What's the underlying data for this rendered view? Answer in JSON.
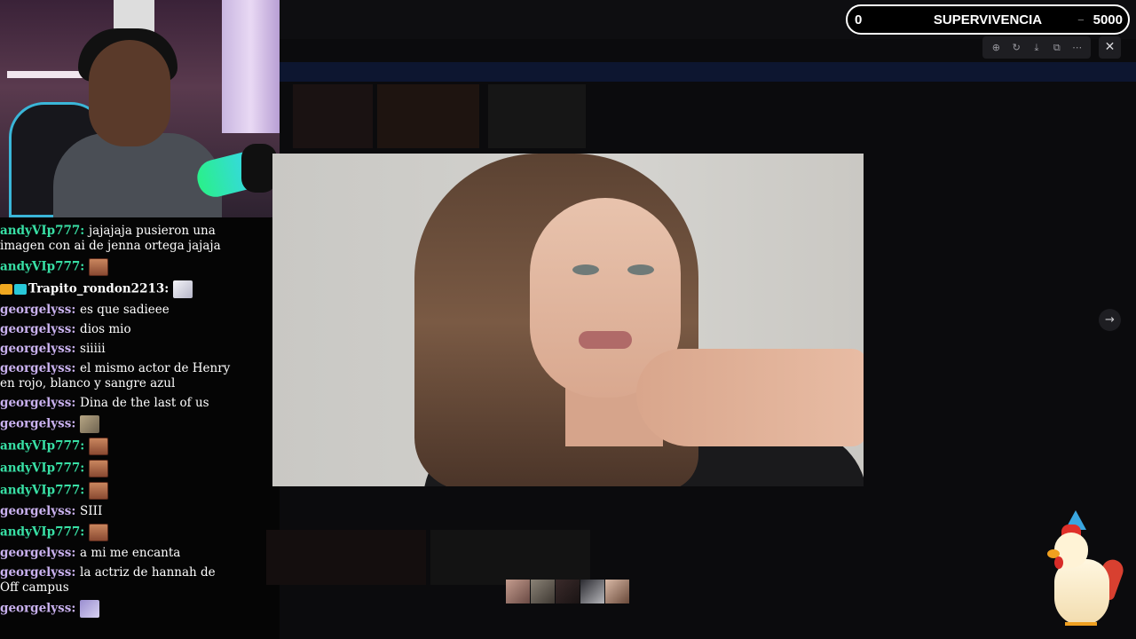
{
  "chat": {
    "messages": [
      {
        "user": "andyVIp777",
        "color": "green",
        "text": "jajajaja pusieron una imagen con ai de jenna ortega jajaja",
        "emote": null
      },
      {
        "user": "andyVIp777",
        "color": "green",
        "text": "",
        "emote": "face"
      },
      {
        "user": "Trapito_rondon2213",
        "color": "white",
        "text": "",
        "emote": "cat",
        "badges": [
          "crown-badge",
          "cyan-badge"
        ]
      },
      {
        "user": "georgelyss",
        "color": "purple",
        "text": "es que sadieee",
        "emote": null
      },
      {
        "user": "georgelyss",
        "color": "purple",
        "text": "dios mio",
        "emote": null
      },
      {
        "user": "georgelyss",
        "color": "purple",
        "text": "siiiii",
        "emote": null
      },
      {
        "user": "georgelyss",
        "color": "purple",
        "text": "el mismo actor de Henry en rojo, blanco y sangre azul",
        "emote": null
      },
      {
        "user": "georgelyss",
        "color": "purple",
        "text": "Dina de the last of us",
        "emote": null
      },
      {
        "user": "georgelyss",
        "color": "purple",
        "text": "",
        "emote": "photo"
      },
      {
        "user": "andyVIp777",
        "color": "green",
        "text": "",
        "emote": "face"
      },
      {
        "user": "andyVIp777",
        "color": "green",
        "text": "",
        "emote": "face"
      },
      {
        "user": "andyVIp777",
        "color": "green",
        "text": "",
        "emote": "face"
      },
      {
        "user": "georgelyss",
        "color": "purple",
        "text": "SIII",
        "emote": null
      },
      {
        "user": "andyVIp777",
        "color": "green",
        "text": "",
        "emote": "face"
      },
      {
        "user": "georgelyss",
        "color": "purple",
        "text": "a mi me encanta",
        "emote": null
      },
      {
        "user": "georgelyss",
        "color": "purple",
        "text": "la actriz de hannah de Off campus",
        "emote": null
      },
      {
        "user": "georgelyss",
        "color": "purple",
        "text": "",
        "emote": "frame"
      }
    ]
  },
  "survival": {
    "left_value": "0",
    "title": "SUPERVIVENCIA",
    "right_value": "5000",
    "dash": "_"
  },
  "viewer": {
    "tools": [
      "zoom-in-icon",
      "rotate-icon",
      "download-icon",
      "open-external-icon",
      "more-icon"
    ],
    "close_glyph": "✕",
    "next_glyph": "→"
  },
  "thumbnails": 5,
  "colors": {
    "username_green": "#38e0a5",
    "username_purple": "#cab2f0",
    "background": "#050505"
  }
}
